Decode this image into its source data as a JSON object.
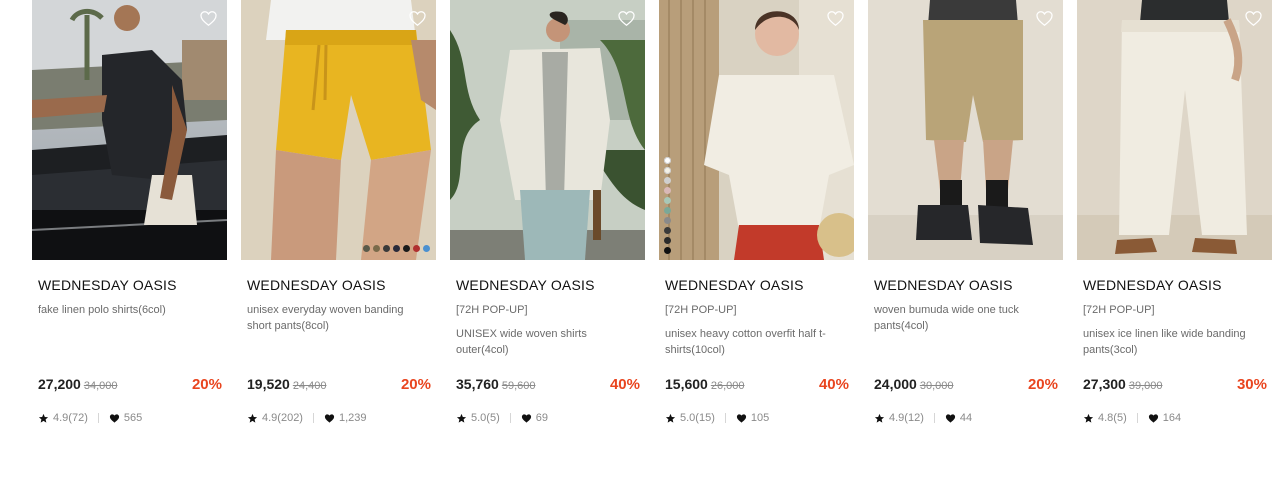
{
  "colors": {
    "discount": "#e9451f",
    "text_gray": "#6b6b6b"
  },
  "icons": {
    "wishlist": "heart-outline-icon",
    "rating": "star-icon",
    "likes": "heart-filled-icon"
  },
  "products": [
    {
      "brand": "WEDNESDAY OASIS",
      "tag": "",
      "name": "fake linen polo shirts(6col)",
      "price": "27,200",
      "original_price": "34,000",
      "discount": "20%",
      "rating": "4.9(72)",
      "likes": "565",
      "swatches": []
    },
    {
      "brand": "WEDNESDAY OASIS",
      "tag": "",
      "name": "unisex everyday woven banding short pants(8col)",
      "price": "19,520",
      "original_price": "24,400",
      "discount": "20%",
      "rating": "4.9(202)",
      "likes": "1,239",
      "swatches": [
        "#5a5a4a",
        "#7a6a4a",
        "#3a3a3a",
        "#2a2a3a",
        "#1a1a1a",
        "#b03030",
        "#4a90d0"
      ]
    },
    {
      "brand": "WEDNESDAY OASIS",
      "tag": "[72H POP-UP]",
      "name": "UNISEX wide woven shirts outer(4col)",
      "price": "35,760",
      "original_price": "59,600",
      "discount": "40%",
      "rating": "5.0(5)",
      "likes": "69",
      "swatches": []
    },
    {
      "brand": "WEDNESDAY OASIS",
      "tag": "[72H POP-UP]",
      "name": "unisex heavy cotton overfit half t-shirts(10col)",
      "price": "15,600",
      "original_price": "26,000",
      "discount": "40%",
      "rating": "5.0(15)",
      "likes": "105",
      "swatches": [
        "#ffffff",
        "#f4f1e6",
        "#cfcfcf",
        "#d9b8b8",
        "#a8c8b8",
        "#7aa898",
        "#8a8a8a",
        "#3a3a3a",
        "#2a2a2a",
        "#111111"
      ]
    },
    {
      "brand": "WEDNESDAY OASIS",
      "tag": "",
      "name": "woven bumuda wide one tuck pants(4col)",
      "price": "24,000",
      "original_price": "30,000",
      "discount": "20%",
      "rating": "4.9(12)",
      "likes": "44",
      "swatches": []
    },
    {
      "brand": "WEDNESDAY OASIS",
      "tag": "[72H POP-UP]",
      "name": "unisex ice linen like wide banding pants(3col)",
      "price": "27,300",
      "original_price": "39,000",
      "discount": "30%",
      "rating": "4.8(5)",
      "likes": "164",
      "swatches": []
    }
  ]
}
